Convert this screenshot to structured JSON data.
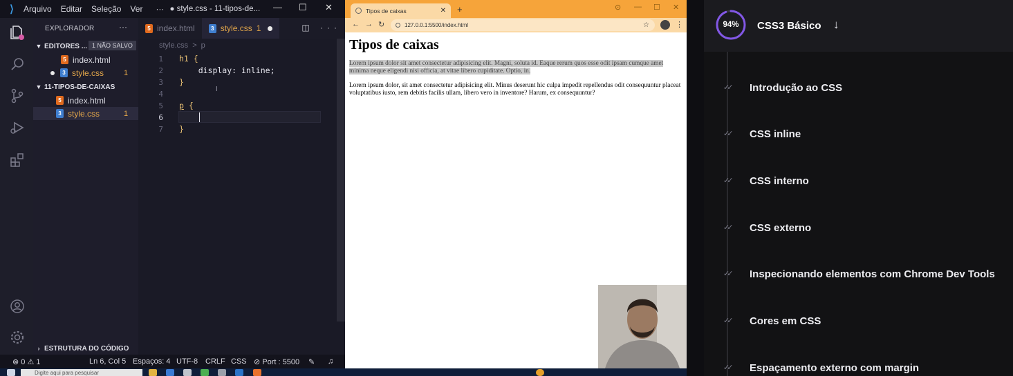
{
  "vscode": {
    "menu": [
      "Arquivo",
      "Editar",
      "Seleção",
      "Ver"
    ],
    "more_menu": "···",
    "window_title": "● style.css - 11-tipos-de...",
    "window_controls": [
      "—",
      "☐",
      "✕"
    ],
    "explorer_title": "EXPLORADOR",
    "explorer_more": "···",
    "open_editors": {
      "title": "EDITORES ...",
      "badge": "1 NÃO SALVO",
      "files": [
        {
          "name": "index.html",
          "type": "html"
        },
        {
          "name": "style.css",
          "type": "css",
          "count": "1",
          "dirty": true
        }
      ]
    },
    "folder": {
      "title": "11-TIPOS-DE-CAIXAS",
      "files": [
        {
          "name": "index.html",
          "type": "html"
        },
        {
          "name": "style.css",
          "type": "css",
          "count": "1"
        }
      ]
    },
    "outline": "ESTRUTURA DO CÓDIGO",
    "tabs": [
      {
        "name": "index.html",
        "type": "html",
        "active": false
      },
      {
        "name": "style.css",
        "type": "css",
        "active": true,
        "count": "1"
      }
    ],
    "breadcrumb": [
      "style.css",
      ">",
      "p"
    ],
    "line_numbers": [
      "1",
      "2",
      "3",
      "4",
      "5",
      "6",
      "7"
    ],
    "code": {
      "l1_sel": "h1",
      "l1_br": " {",
      "l2_prop": "    display: inline;",
      "l3_br": "}",
      "l5_sel": "p",
      "l5_br": " {",
      "l7_br": "}"
    },
    "status": {
      "problems": "⊗ 0 ⚠ 1",
      "position": "Ln 6, Col 5",
      "spaces": "Espaços: 4",
      "encoding": "UTF-8",
      "eol": "CRLF",
      "language": "CSS",
      "port": "⊘ Port : 5500"
    },
    "taskbar_search": "Digite aqui para pesquisar"
  },
  "browser": {
    "tab_title": "Tipos de caixas",
    "tab_close": "✕",
    "new_tab": "+",
    "controls": [
      "⊙",
      "—",
      "☐",
      "✕"
    ],
    "nav": [
      "←",
      "→",
      "↻"
    ],
    "url": "127.0.0.1:5500/index.html",
    "page": {
      "heading": "Tipos de caixas",
      "paragraph1": "Lorem ipsum dolor sit amet consectetur adipisicing elit. Magni, soluta id. Eaque rerum quos esse odit ipsam cumque amet minima neque eligendi nisi officia, at vitae libero cupiditate. Optio, in.",
      "paragraph2": "Lorem ipsum dolor, sit amet consectetur adipisicing elit. Minus deserunt hic culpa impedit repellendus odit consequuntur placeat voluptatibus iusto, rem debitis facilis ullam, libero vero in inventore? Harum, ex consequuntur?"
    }
  },
  "course": {
    "progress_label": "94%",
    "progress_value": 0.94,
    "accent": "#8257e5",
    "title": "CSS3 Básico",
    "arrow": "↓",
    "lessons": [
      "Introdução ao CSS",
      "CSS inline",
      "CSS interno",
      "CSS externo",
      "Inspecionando elementos com Chrome Dev Tools",
      "Cores em CSS",
      "Espaçamento externo com margin"
    ]
  }
}
